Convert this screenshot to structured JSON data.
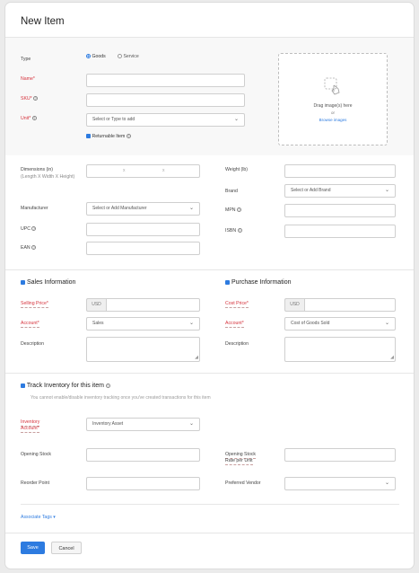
{
  "title": "New Item",
  "type": {
    "label": "Type",
    "goods": "Goods",
    "service": "Service",
    "selected": "Goods"
  },
  "name": {
    "label": "Name*"
  },
  "sku": {
    "label": "SKU*"
  },
  "unit": {
    "label": "Unit*",
    "placeholder": "Select or Type to add"
  },
  "returnable": {
    "label": "Returnable Item",
    "checked": true
  },
  "image_drop": {
    "text": "Drag image(s) here",
    "or": "or",
    "link": "Browse images"
  },
  "dimensions": {
    "label": "Dimensions (in)",
    "sublabel": "(Length X Width X Height)",
    "sep1": "x",
    "sep2": "x"
  },
  "weight": {
    "label": "Weight (lb)"
  },
  "brand": {
    "label": "Brand",
    "placeholder": "Select or Add Brand"
  },
  "manufacturer": {
    "label": "Manufacturer",
    "placeholder": "Select or Add Manufacturer"
  },
  "mpn": {
    "label": "MPN"
  },
  "upc": {
    "label": "UPC"
  },
  "isbn": {
    "label": "ISBN"
  },
  "ean": {
    "label": "EAN"
  },
  "sales": {
    "heading": "Sales Information",
    "price_label": "Selling Price*",
    "currency": "USD",
    "account_label": "Account*",
    "account_value": "Sales",
    "desc_label": "Description"
  },
  "purchase": {
    "heading": "Purchase Information",
    "price_label": "Cost Price*",
    "currency": "USD",
    "account_label": "Account*",
    "account_value": "Cost of Goods Sold",
    "desc_label": "Description"
  },
  "inventory": {
    "heading": "Track Inventory for this item",
    "note": "You cannot enable/disable inventory tracking once you've created transactions for this item",
    "account_label_1": "Inventory",
    "account_label_2": "Account*",
    "account_value": "Inventory Asset",
    "opening_stock": "Opening Stock",
    "opening_rate_1": "Opening Stock",
    "opening_rate_2": "Rate per Unit",
    "reorder": "Reorder Point",
    "vendor": "Preferred Vendor"
  },
  "tags": {
    "label": "Associate Tags"
  },
  "buttons": {
    "save": "Save",
    "cancel": "Cancel"
  },
  "colors": {
    "accent": "#2d7be0",
    "required": "#d6323c"
  }
}
